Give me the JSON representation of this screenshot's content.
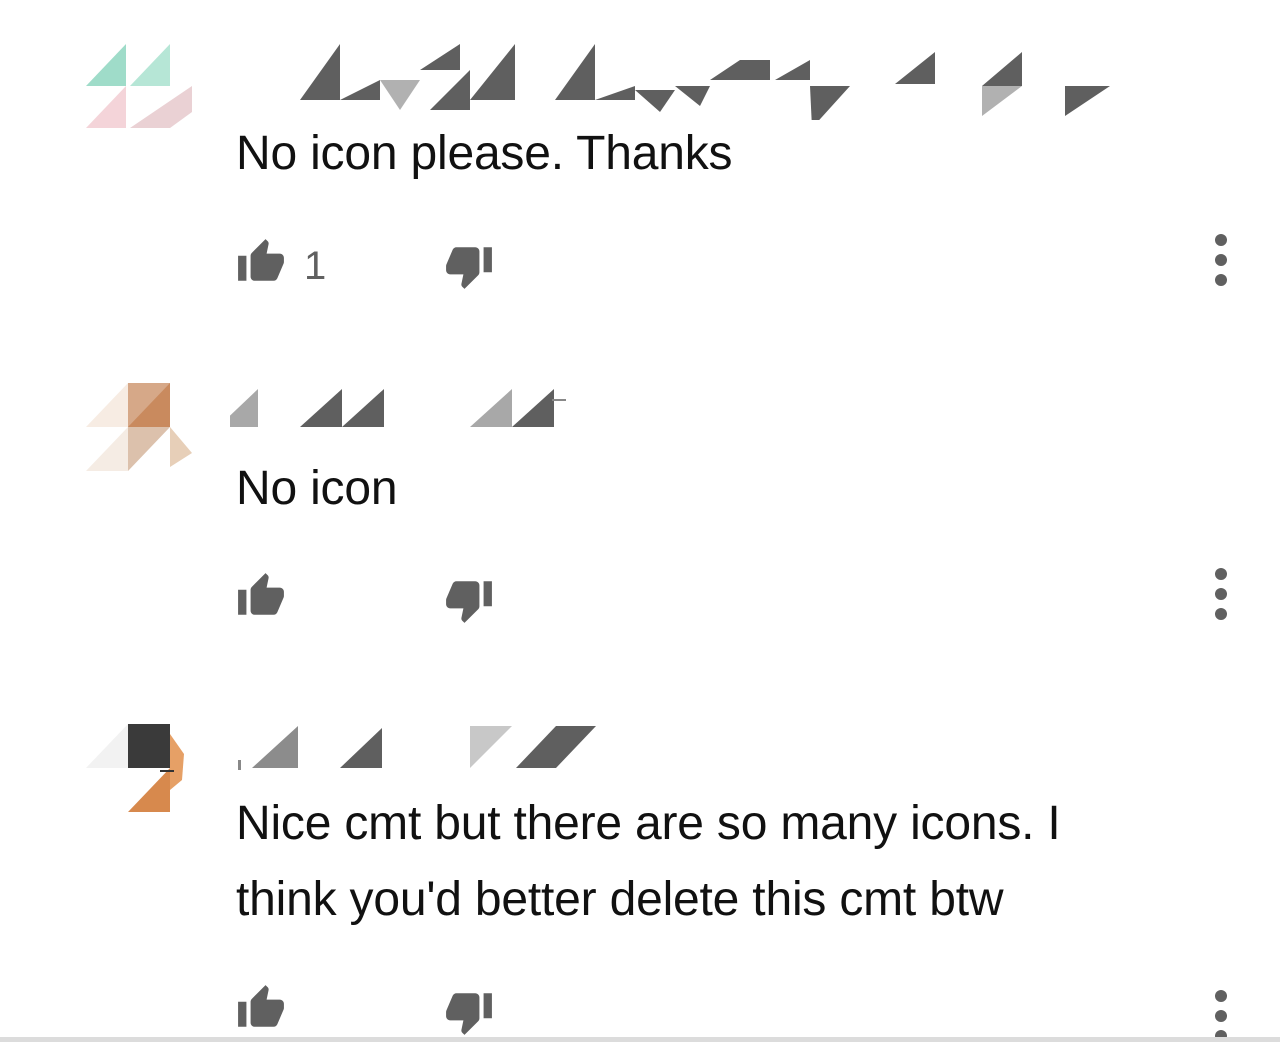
{
  "comments": [
    {
      "text": "No icon please. Thanks",
      "like_count": "1",
      "avatar_colors": [
        "#9fdcc9",
        "#f2c9cf"
      ]
    },
    {
      "text": "No icon",
      "like_count": "",
      "avatar_colors": [
        "#c98a5e",
        "#e7cfb8"
      ]
    },
    {
      "text": "Nice cmt but there are so many icons. I think you'd better delete this cmt btw",
      "like_count": "",
      "avatar_colors": [
        "#3a3a3a",
        "#d7894d"
      ]
    }
  ],
  "icons": {
    "like": "thumbs-up-icon",
    "dislike": "thumbs-down-icon",
    "more": "more-vertical-icon"
  },
  "colors": {
    "text": "#111111",
    "icon": "#606060",
    "redaction_dark": "#5f5f5f",
    "redaction_light": "#b1b1b1"
  }
}
